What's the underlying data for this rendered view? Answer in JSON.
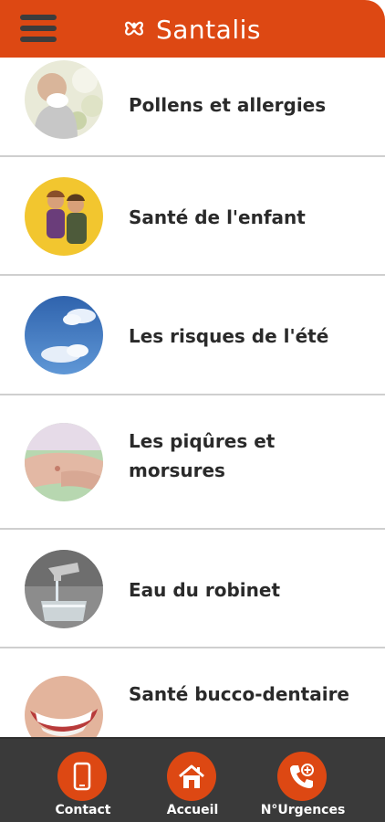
{
  "colors": {
    "brand": "#dd4813",
    "nav_bg": "#3a3a3a",
    "text": "#2a2a2a",
    "divider": "#cfcfcf"
  },
  "header": {
    "title": "Santalis",
    "menu_icon": "hamburger-menu-icon",
    "logo_icon": "santalis-flower-logo"
  },
  "topics": [
    {
      "label": "Pollens et allergies",
      "image": "person-sneezing-flowers-photo"
    },
    {
      "label": "Santé de l'enfant",
      "image": "two-children-photo"
    },
    {
      "label": "Les risques de l'été",
      "image": "blue-sky-clouds-photo"
    },
    {
      "label": "Les piqûres et morsures",
      "image": "arm-insect-bite-photo"
    },
    {
      "label": "Eau du robinet",
      "image": "tap-water-glass-photo"
    },
    {
      "label": "Santé bucco-dentaire",
      "image": "smiling-teeth-photo"
    }
  ],
  "bottom_nav": [
    {
      "label": "Contact",
      "icon": "phone-icon"
    },
    {
      "label": "Accueil",
      "icon": "home-icon"
    },
    {
      "label": "N°Urgences",
      "icon": "emergency-call-icon"
    }
  ]
}
